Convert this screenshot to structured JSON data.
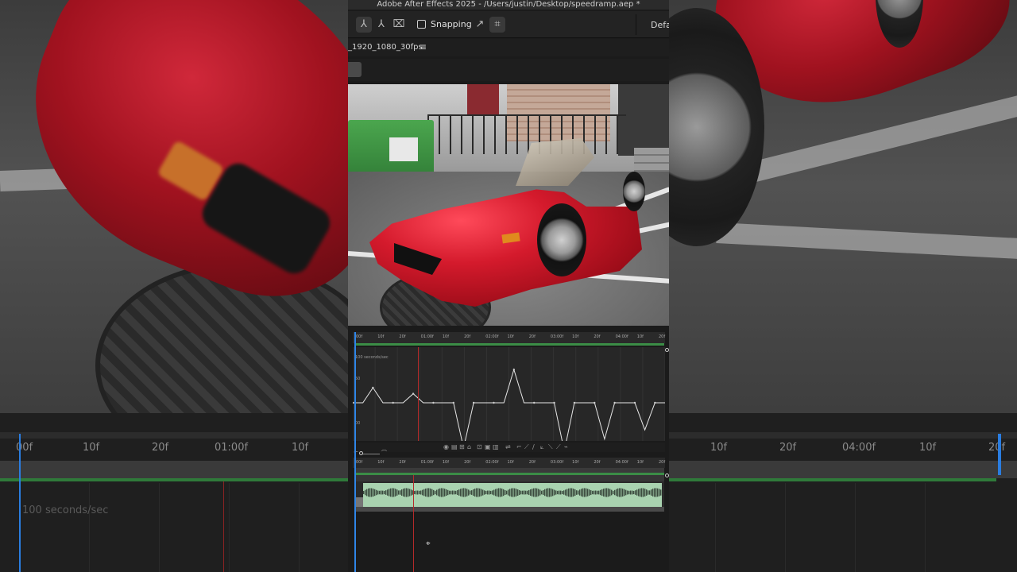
{
  "window": {
    "title": "Adobe After Effects 2025 - /Users/justin/Desktop/speedramp.aep *"
  },
  "toolbar": {
    "snapping_label": "Snapping",
    "workspace_label": "Defau"
  },
  "composition": {
    "name": "_1920_1080_30fps"
  },
  "graph_editor": {
    "speed_label": "100 seconds/sec",
    "ruler_ticks": [
      "00f",
      "10f",
      "20f",
      "01:00f",
      "10f",
      "20f",
      "02:00f",
      "10f",
      "20f",
      "03:00f",
      "10f",
      "20f",
      "04:00f",
      "10f",
      "20f"
    ],
    "y_ticks": [
      "50",
      "00"
    ],
    "speed_curve": [
      0.5,
      0.5,
      1.0,
      0.5,
      0.5,
      0.5,
      0.8,
      0.5,
      0.5,
      0.5,
      0.5,
      -1.0,
      0.5,
      0.5,
      0.5,
      0.5,
      1.6,
      0.5,
      0.5,
      0.5,
      0.5,
      -1.1,
      0.5,
      0.5,
      0.5,
      -0.7,
      0.5,
      0.5,
      0.5,
      -0.4,
      0.5,
      0.5
    ]
  },
  "timeline": {
    "ruler_ticks": [
      "00f",
      "10f",
      "20f",
      "01:00f",
      "10f",
      "20f",
      "02:00f",
      "10f",
      "20f",
      "03:00f",
      "10f",
      "20f",
      "04:00f",
      "10f",
      "20f"
    ]
  },
  "background_timeline": {
    "ruler_ticks": [
      "00f",
      "10f",
      "20f",
      "01:00f",
      "10f"
    ],
    "ruler_ticks_right": [
      "10f",
      "20f",
      "04:00f",
      "10f",
      "20f"
    ],
    "speed_label": "100 seconds/sec"
  },
  "colors": {
    "accent_blue": "#2f86e8",
    "playhead_red": "#b52a2a",
    "work_area_green": "#3b8d46",
    "audio_waveform": "#a9d3b0"
  }
}
